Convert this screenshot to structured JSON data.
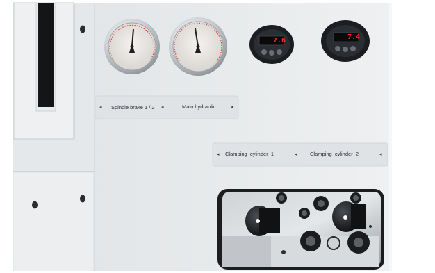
{
  "gauges": [
    {
      "name": "gauge-spindle-brake",
      "icon": "pressure-gauge-icon"
    },
    {
      "name": "gauge-main-hydraulic",
      "icon": "pressure-gauge-icon"
    }
  ],
  "displays": [
    {
      "reading": "7.6",
      "icon": "digital-pressure-display-icon"
    },
    {
      "reading": "7.4",
      "icon": "digital-pressure-display-icon"
    }
  ],
  "labels_row1": {
    "spindle_brake": "Spindle brake 1 / 2",
    "main_hydraulic": "Main hydraulic"
  },
  "labels_row2": {
    "clamping_1": "Clamping  cylinder  1",
    "clamping_2": "Clamping  cylinder  2"
  },
  "colors": {
    "panel": "#e9ecee",
    "display_red": "#ff2a2a",
    "knob": "#1a1c1f"
  }
}
